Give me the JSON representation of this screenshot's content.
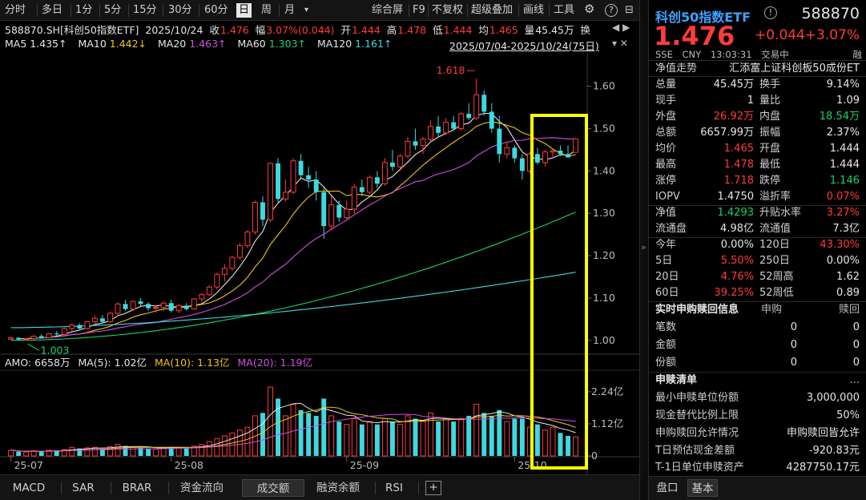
{
  "toolbar": {
    "periods": [
      "分时",
      "多日",
      "1分",
      "5分",
      "15分",
      "30分",
      "60分",
      "日",
      "周",
      "月"
    ],
    "active_period": "日",
    "right_items": [
      "综合屏",
      "F9",
      "不复权",
      "超级叠加",
      "画线",
      "工具"
    ],
    "icons": [
      "dropdown-icon",
      "gear-icon",
      "help-icon",
      "collapse-icon"
    ]
  },
  "info_row": {
    "code_name": "588870.SH[科创50指数ETF]",
    "date": "2025/10/24",
    "close_label": "收",
    "close": "1.476",
    "change_label": "幅",
    "change": "3.07%(0.044)",
    "open_label": "开",
    "open": "1.444",
    "high_label": "高",
    "high": "1.478",
    "low_label": "低",
    "low": "1.444",
    "avg_label": "均",
    "avg": "1.465",
    "volume_label": "量",
    "volume": "45.45万",
    "more_label": "换"
  },
  "ma_row": {
    "items": [
      {
        "label": "MA5",
        "value": "1.435↑",
        "color": "#e6e6e6"
      },
      {
        "label": "MA10",
        "value": "1.442↓",
        "color": "#f2c318"
      },
      {
        "label": "MA20",
        "value": "1.463↑",
        "color": "#d24fe0"
      },
      {
        "label": "MA60",
        "value": "1.303↑",
        "color": "#19d36b"
      },
      {
        "label": "MA120",
        "value": "1.161↑",
        "color": "#3fd8e0"
      }
    ],
    "range": "2025/07/04-2025/10/24(75日)"
  },
  "chart_data": {
    "type": "candlestick",
    "yticks": [
      "1.60",
      "1.50",
      "1.40",
      "1.30",
      "1.20",
      "1.10",
      "1.00"
    ],
    "ylim": [
      0.975,
      1.66
    ],
    "xticks": [
      "25-07",
      "25-08",
      "25-09",
      "25-10"
    ],
    "max_label": "1.618",
    "min_label": "1.003",
    "candles": [
      [
        1.003,
        1.008,
        1.001,
        1.006
      ],
      [
        1.006,
        1.008,
        1.0,
        1.002
      ],
      [
        1.002,
        1.006,
        0.999,
        1.004
      ],
      [
        1.004,
        1.012,
        1.002,
        1.01
      ],
      [
        1.01,
        1.015,
        1.004,
        1.006
      ],
      [
        1.006,
        1.018,
        1.005,
        1.016
      ],
      [
        1.016,
        1.022,
        1.01,
        1.014
      ],
      [
        1.014,
        1.03,
        1.012,
        1.028
      ],
      [
        1.028,
        1.04,
        1.02,
        1.036
      ],
      [
        1.036,
        1.04,
        1.024,
        1.028
      ],
      [
        1.028,
        1.046,
        1.026,
        1.044
      ],
      [
        1.044,
        1.058,
        1.04,
        1.052
      ],
      [
        1.052,
        1.06,
        1.04,
        1.044
      ],
      [
        1.044,
        1.068,
        1.042,
        1.064
      ],
      [
        1.064,
        1.09,
        1.06,
        1.086
      ],
      [
        1.086,
        1.096,
        1.07,
        1.074
      ],
      [
        1.074,
        1.094,
        1.07,
        1.092
      ],
      [
        1.092,
        1.1,
        1.08,
        1.086
      ],
      [
        1.086,
        1.09,
        1.07,
        1.076
      ],
      [
        1.076,
        1.084,
        1.066,
        1.078
      ],
      [
        1.078,
        1.092,
        1.07,
        1.088
      ],
      [
        1.088,
        1.096,
        1.066,
        1.07
      ],
      [
        1.07,
        1.086,
        1.064,
        1.082
      ],
      [
        1.082,
        1.088,
        1.07,
        1.074
      ],
      [
        1.074,
        1.1,
        1.072,
        1.098
      ],
      [
        1.098,
        1.112,
        1.09,
        1.108
      ],
      [
        1.108,
        1.13,
        1.104,
        1.126
      ],
      [
        1.126,
        1.16,
        1.12,
        1.156
      ],
      [
        1.156,
        1.18,
        1.14,
        1.17
      ],
      [
        1.17,
        1.2,
        1.164,
        1.196
      ],
      [
        1.196,
        1.23,
        1.19,
        1.224
      ],
      [
        1.224,
        1.26,
        1.218,
        1.256
      ],
      [
        1.256,
        1.33,
        1.25,
        1.326
      ],
      [
        1.326,
        1.34,
        1.27,
        1.285
      ],
      [
        1.285,
        1.42,
        1.28,
        1.418
      ],
      [
        1.418,
        1.43,
        1.326,
        1.334
      ],
      [
        1.334,
        1.38,
        1.328,
        1.35
      ],
      [
        1.35,
        1.43,
        1.345,
        1.424
      ],
      [
        1.424,
        1.44,
        1.38,
        1.39
      ],
      [
        1.39,
        1.41,
        1.36,
        1.38
      ],
      [
        1.38,
        1.4,
        1.33,
        1.35
      ],
      [
        1.35,
        1.36,
        1.24,
        1.27
      ],
      [
        1.27,
        1.34,
        1.26,
        1.32
      ],
      [
        1.32,
        1.33,
        1.28,
        1.29
      ],
      [
        1.29,
        1.33,
        1.285,
        1.31
      ],
      [
        1.31,
        1.37,
        1.3,
        1.362
      ],
      [
        1.362,
        1.38,
        1.34,
        1.35
      ],
      [
        1.35,
        1.39,
        1.345,
        1.385
      ],
      [
        1.385,
        1.4,
        1.36,
        1.37
      ],
      [
        1.37,
        1.43,
        1.365,
        1.42
      ],
      [
        1.42,
        1.45,
        1.4,
        1.41
      ],
      [
        1.41,
        1.44,
        1.4,
        1.435
      ],
      [
        1.435,
        1.48,
        1.43,
        1.47
      ],
      [
        1.47,
        1.5,
        1.45,
        1.46
      ],
      [
        1.46,
        1.48,
        1.44,
        1.475
      ],
      [
        1.475,
        1.52,
        1.47,
        1.505
      ],
      [
        1.505,
        1.53,
        1.48,
        1.49
      ],
      [
        1.49,
        1.525,
        1.485,
        1.515
      ],
      [
        1.515,
        1.53,
        1.495,
        1.5
      ],
      [
        1.5,
        1.54,
        1.495,
        1.535
      ],
      [
        1.535,
        1.56,
        1.52,
        1.525
      ],
      [
        1.525,
        1.618,
        1.52,
        1.58
      ],
      [
        1.58,
        1.59,
        1.53,
        1.54
      ],
      [
        1.54,
        1.56,
        1.49,
        1.5
      ],
      [
        1.5,
        1.53,
        1.42,
        1.44
      ],
      [
        1.44,
        1.47,
        1.43,
        1.455
      ],
      [
        1.455,
        1.46,
        1.42,
        1.43
      ],
      [
        1.43,
        1.44,
        1.38,
        1.4
      ],
      [
        1.4,
        1.445,
        1.395,
        1.44
      ],
      [
        1.44,
        1.455,
        1.415,
        1.42
      ],
      [
        1.42,
        1.45,
        1.41,
        1.445
      ],
      [
        1.445,
        1.45,
        1.43,
        1.448
      ],
      [
        1.448,
        1.46,
        1.435,
        1.44
      ],
      [
        1.44,
        1.46,
        1.435,
        1.432
      ],
      [
        1.444,
        1.478,
        1.444,
        1.476
      ]
    ],
    "ma_colors": {
      "ma5": "#e6e6e6",
      "ma10": "#f2c318",
      "ma20": "#d24fe0",
      "ma60": "#19d36b",
      "ma120": "#3fd8e0"
    },
    "ma60_end": 1.303,
    "ma60_start": 1.0,
    "ma120_end": 1.161,
    "ma120_start": 1.03,
    "volume_yticks": [
      "2.24亿",
      "1.12亿",
      "0"
    ],
    "volume_max": 2.6,
    "volumes": [
      0.2,
      0.15,
      0.14,
      0.18,
      0.16,
      0.2,
      0.18,
      0.22,
      0.3,
      0.26,
      0.28,
      0.3,
      0.25,
      0.32,
      0.4,
      0.35,
      0.3,
      0.28,
      0.26,
      0.24,
      0.3,
      0.32,
      0.28,
      0.26,
      0.34,
      0.4,
      0.5,
      0.6,
      0.7,
      0.8,
      0.9,
      1.0,
      1.4,
      1.5,
      2.4,
      2.0,
      1.4,
      1.8,
      1.6,
      1.5,
      1.4,
      2.0,
      1.4,
      1.2,
      1.1,
      1.3,
      1.1,
      1.2,
      1.1,
      1.3,
      1.2,
      1.1,
      1.4,
      1.3,
      1.2,
      1.5,
      1.2,
      1.3,
      1.2,
      1.3,
      1.4,
      1.8,
      1.5,
      1.4,
      1.6,
      1.2,
      1.3,
      1.3,
      1.0,
      1.1,
      0.9,
      1.0,
      0.8,
      0.7,
      0.66
    ],
    "amo_label": "AMO: 6658万",
    "amo_ma5": "MA(5): 1.02亿",
    "amo_ma10": "MA(10): 1.13亿",
    "amo_ma20": "MA(20): 1.19亿",
    "colors": {
      "up": "#ff3b3b",
      "down": "#3fd8e0",
      "highlight": "#ffff00"
    }
  },
  "bottom_tabs": [
    "MACD",
    "SAR",
    "BRAR",
    "资金流向",
    "成交额",
    "融资余额",
    "RSI"
  ],
  "bottom_active": "成交额",
  "right_panel": {
    "name": "科创50指数ETF",
    "code": "588870",
    "price": "1.476",
    "change": "+0.044",
    "change_pct": "+3.07%",
    "meta": [
      "SSE",
      "CNY",
      "13:03:31",
      "交易中"
    ],
    "meta_right": "融",
    "nav_label": "净值走势",
    "fund_name": "汇添富上证科创板50成份ET",
    "stats": [
      {
        "l1": "总量",
        "v1": "45.45万",
        "c1": "#e6e6e6",
        "l2": "换手",
        "v2": "9.14%",
        "c2": "#e6e6e6"
      },
      {
        "l1": "现手",
        "v1": "1",
        "c1": "#e6e6e6",
        "l2": "量比",
        "v2": "1.09",
        "c2": "#e6e6e6"
      },
      {
        "l1": "外盘",
        "v1": "26.92万",
        "c1": "#ff3b3b",
        "l2": "内盘",
        "v2": "18.54万",
        "c2": "#19d36b"
      },
      {
        "l1": "总额",
        "v1": "6657.99万",
        "c1": "#e6e6e6",
        "l2": "振幅",
        "v2": "2.37%",
        "c2": "#e6e6e6"
      },
      {
        "l1": "均价",
        "v1": "1.465",
        "c1": "#ff3b3b",
        "l2": "开盘",
        "v2": "1.444",
        "c2": "#e6e6e6"
      },
      {
        "l1": "最高",
        "v1": "1.478",
        "c1": "#ff3b3b",
        "l2": "最低",
        "v2": "1.444",
        "c2": "#e6e6e6"
      },
      {
        "l1": "涨停",
        "v1": "1.718",
        "c1": "#ff3b3b",
        "l2": "跌停",
        "v2": "1.146",
        "c2": "#19d36b"
      },
      {
        "l1": "IOPV",
        "v1": "1.4750",
        "c1": "#e6e6e6",
        "l2": "溢折率",
        "v2": "0.07%",
        "c2": "#ff3b3b"
      },
      {
        "l1": "净值",
        "v1": "1.4293",
        "c1": "#19d36b",
        "l2": "升贴水率",
        "v2": "3.27%",
        "c2": "#ff3b3b"
      },
      {
        "l1": "流通盘",
        "v1": "4.98亿",
        "c1": "#e6e6e6",
        "l2": "流通值",
        "v2": "7.3亿",
        "c2": "#e6e6e6"
      },
      {
        "l1": "今年",
        "v1": "0.00%",
        "c1": "#e6e6e6",
        "l2": "120日",
        "v2": "43.30%",
        "c2": "#ff3b3b"
      },
      {
        "l1": "5日",
        "v1": "5.50%",
        "c1": "#ff3b3b",
        "l2": "250日",
        "v2": "0.00%",
        "c2": "#e6e6e6"
      },
      {
        "l1": "20日",
        "v1": "4.76%",
        "c1": "#ff3b3b",
        "l2": "52周高",
        "v2": "1.62",
        "c2": "#e6e6e6"
      },
      {
        "l1": "60日",
        "v1": "39.25%",
        "c1": "#ff3b3b",
        "l2": "52周低",
        "v2": "0.89",
        "c2": "#e6e6e6"
      }
    ],
    "sub_head": {
      "title": "实时申购赎回信息",
      "col1": "申购",
      "col2": "赎回"
    },
    "sub_rows": [
      {
        "label": "笔数",
        "v1": "0",
        "v2": "0"
      },
      {
        "label": "金额",
        "v1": "0",
        "v2": "0"
      },
      {
        "label": "份额",
        "v1": "0",
        "v2": "0"
      }
    ],
    "ap_head": "申赎清单",
    "ap_more": "...",
    "ap_rows": [
      {
        "label": "最小申赎单位份额",
        "value": "3,000,000"
      },
      {
        "label": "现金替代比例上限",
        "value": "50%"
      },
      {
        "label": "申购赎回允许情况",
        "value": "申购赎回皆允许"
      },
      {
        "label": "T日预估现金差额",
        "value": "-920.83元"
      },
      {
        "label": "T-1日单位申赎资产",
        "value": "4287750.17元"
      }
    ],
    "tabs": [
      "盘口",
      "基本"
    ],
    "active_tab": "基本"
  }
}
